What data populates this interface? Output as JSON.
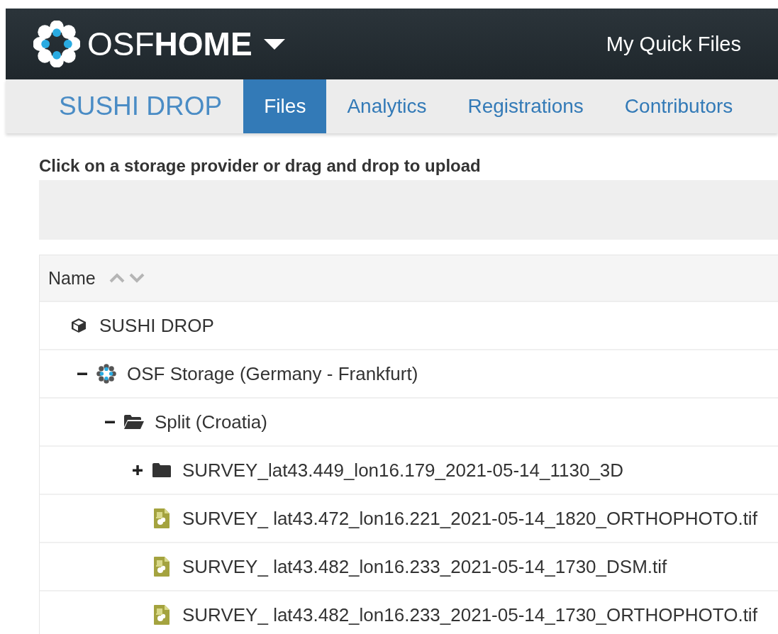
{
  "navbar": {
    "brand_light": "OSF",
    "brand_bold": "HOME",
    "link": "My Quick Files"
  },
  "project_nav": {
    "title": "SUSHI DROP",
    "tabs": [
      {
        "label": "Files",
        "selected": true
      },
      {
        "label": "Analytics",
        "selected": false
      },
      {
        "label": "Registrations",
        "selected": false
      },
      {
        "label": "Contributors",
        "selected": false
      }
    ]
  },
  "upload_hint": "Click on a storage provider or drag and drop to upload",
  "file_tree": {
    "columns": [
      "Name"
    ],
    "items": [
      {
        "kind": "project",
        "name": "SUSHI DROP",
        "children": [
          {
            "kind": "storage",
            "name": "OSF Storage (Germany - Frankfurt)",
            "expanded": true,
            "children": [
              {
                "kind": "folder",
                "name": "Split (Croatia)",
                "expanded": true,
                "children": [
                  {
                    "kind": "folder",
                    "name": "SURVEY_lat43.449_lon16.179_2021-05-14_1130_3D",
                    "expanded": false
                  },
                  {
                    "kind": "file",
                    "name": "SURVEY_ lat43.472_lon16.221_2021-05-14_1820_ORTHOPHOTO.tif"
                  },
                  {
                    "kind": "file",
                    "name": "SURVEY_ lat43.482_lon16.233_2021-05-14_1730_DSM.tif"
                  },
                  {
                    "kind": "file",
                    "name": "SURVEY_ lat43.482_lon16.233_2021-05-14_1730_ORTHOPHOTO.tif"
                  }
                ]
              }
            ]
          }
        ]
      }
    ]
  }
}
